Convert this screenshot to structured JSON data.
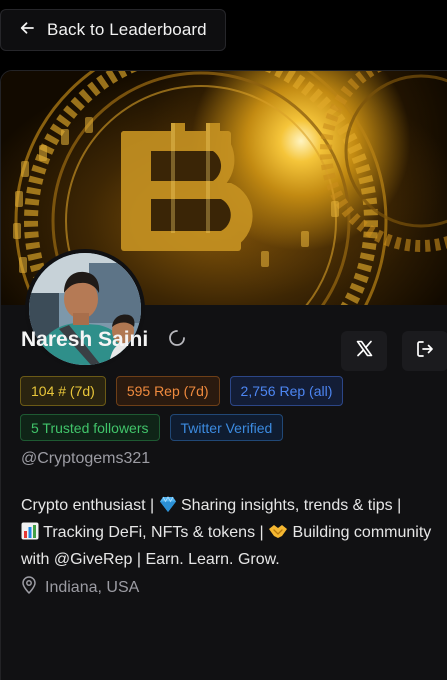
{
  "nav": {
    "back_label": "Back to Leaderboard"
  },
  "profile": {
    "name": "Naresh Saini",
    "handle": "@Cryptogems321",
    "badges": {
      "rank": "104 # (7d)",
      "rep_7d": "595 Rep (7d)",
      "rep_all": "2,756 Rep (all)",
      "trusted": "5 Trusted followers",
      "twitter": "Twitter Verified"
    },
    "bio": {
      "part1": "Crypto enthusiast | ",
      "part2": " Sharing insights, trends & tips | ",
      "part3": " Tracking DeFi, NFTs & tokens | ",
      "part4": " Building community with @GiveRep | Earn. Learn. Grow."
    },
    "location": "Indiana, USA"
  },
  "icons": {
    "back": "arrow-left-icon",
    "x": "x-logo-icon",
    "share": "share-exit-icon",
    "loading": "spinner-icon",
    "location": "map-pin-icon",
    "bio_emojis": [
      "gem-icon",
      "bar-chart-icon",
      "handshake-icon"
    ]
  },
  "colors": {
    "rank": "#e8c63a",
    "rep_7d": "#ef8a3e",
    "rep_all": "#4d86f2",
    "trusted": "#41c46a",
    "twitter": "#3c8be0"
  }
}
